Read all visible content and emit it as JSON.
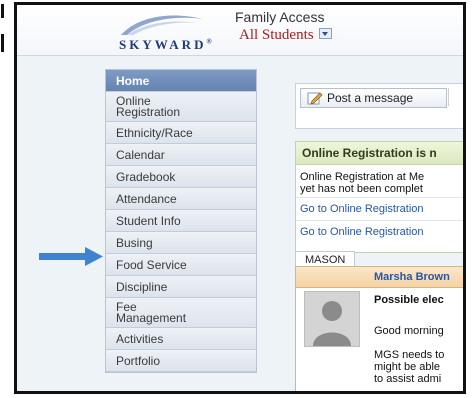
{
  "header": {
    "logo_text": "SKYWARD",
    "logo_mark": "®",
    "product_name": "Family Access",
    "district_selector": "All Students"
  },
  "sidebar": {
    "items": [
      {
        "label": "Home",
        "active": true
      },
      {
        "label": "Online Registration",
        "lines": [
          "Online",
          "Registration"
        ]
      },
      {
        "label": "Ethnicity/Race"
      },
      {
        "label": "Calendar"
      },
      {
        "label": "Gradebook"
      },
      {
        "label": "Attendance"
      },
      {
        "label": "Student Info"
      },
      {
        "label": "Busing"
      },
      {
        "label": "Food Service"
      },
      {
        "label": "Discipline"
      },
      {
        "label": "Fee Management",
        "lines": [
          "Fee",
          "Management"
        ]
      },
      {
        "label": "Activities"
      },
      {
        "label": "Portfolio"
      }
    ]
  },
  "main": {
    "post_button": "Post a message",
    "registration": {
      "title": "Online Registration is n",
      "text_lines": [
        "Online Registration at Me",
        "yet has not been complet"
      ],
      "links": [
        "Go to Online Registration",
        "Go to Online Registration"
      ]
    },
    "tab": "MASON",
    "message": {
      "sender": "Marsha Brown",
      "subject": "Possible elec",
      "lines": [
        "Good morning",
        "MGS needs to",
        "might be able",
        "to assist admi"
      ]
    }
  },
  "colors": {
    "active_nav": "#6f8dba",
    "link": "#2457a6",
    "district": "#b31b1b",
    "arrow": "#3f83cf"
  }
}
